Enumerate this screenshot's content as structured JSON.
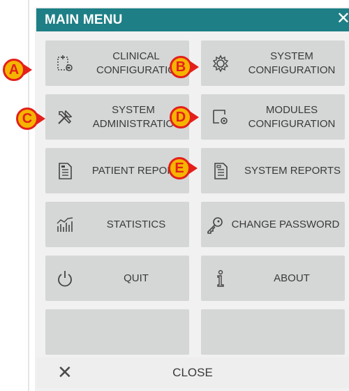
{
  "menu": {
    "title": "MAIN MENU",
    "close_glyph": "✕"
  },
  "buttons": [
    {
      "id": "clinical-configuration",
      "line1": "CLINICAL",
      "line2": "CONFIGURATIO",
      "icon": "clinical-config-icon"
    },
    {
      "id": "system-configuration",
      "line1": "SYSTEM",
      "line2": "CONFIGURATION",
      "icon": "gear-icon"
    },
    {
      "id": "system-administration",
      "line1": "SYSTEM",
      "line2": "ADMINISTRATIO",
      "icon": "tools-icon"
    },
    {
      "id": "modules-configuration",
      "line1": "MODULES",
      "line2": "CONFIGURATION",
      "icon": "modules-config-icon"
    },
    {
      "id": "patient-reports",
      "line1": "PATIENT REPOR",
      "icon": "patient-report-icon"
    },
    {
      "id": "system-reports",
      "line1": "SYSTEM REPORTS",
      "icon": "system-report-icon"
    },
    {
      "id": "statistics",
      "line1": "STATISTICS",
      "icon": "statistics-icon"
    },
    {
      "id": "change-password",
      "line1": "CHANGE PASSWORD",
      "icon": "key-icon"
    },
    {
      "id": "quit",
      "line1": "QUIT",
      "icon": "power-icon"
    },
    {
      "id": "about",
      "line1": "ABOUT",
      "icon": "info-icon"
    }
  ],
  "footer": {
    "close_label": "CLOSE",
    "close_glyph": "✕"
  },
  "badges": [
    "A",
    "B",
    "C",
    "D",
    "E"
  ],
  "colors": {
    "titlebar": "#1e7f86",
    "button_bg": "#d5d6d6",
    "badge_fill": "#f4b400",
    "badge_border": "#e3201b"
  }
}
